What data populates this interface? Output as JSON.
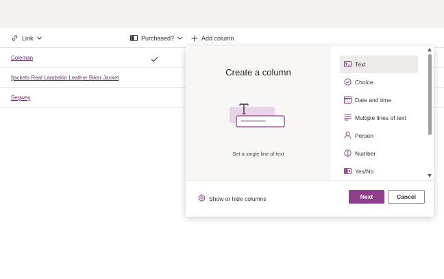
{
  "header": {
    "columns": [
      {
        "label": "Link",
        "icon": "link-icon"
      },
      {
        "label": "Purchased?",
        "icon": "yes-no-icon"
      },
      {
        "label": "Add column",
        "icon": "plus-icon"
      }
    ]
  },
  "rows": [
    {
      "link": "Coleman",
      "purchased": true
    },
    {
      "link": "fjackets Real Lambskin Leather Biker Jacket",
      "purchased": false
    },
    {
      "link": "Segway",
      "purchased": false
    }
  ],
  "panel": {
    "title": "Create a column",
    "description": "Set a single line of text",
    "types": [
      {
        "label": "Text",
        "icon": "text-icon",
        "selected": true
      },
      {
        "label": "Choice",
        "icon": "choice-icon",
        "selected": false
      },
      {
        "label": "Date and time",
        "icon": "calendar-icon",
        "selected": false
      },
      {
        "label": "Multiple lines of text",
        "icon": "multiline-icon",
        "selected": false
      },
      {
        "label": "Person",
        "icon": "person-icon",
        "selected": false
      },
      {
        "label": "Number",
        "icon": "number-icon",
        "selected": false
      },
      {
        "label": "Yes/No",
        "icon": "yes-no-icon",
        "selected": false
      }
    ],
    "show_hide_label": "Show or hide columns",
    "next_label": "Next",
    "cancel_label": "Cancel"
  },
  "colors": {
    "accent": "#8d3f8c",
    "link": "#6b2c6f",
    "icon_purple": "#8d3f8c",
    "selected_bg": "#edebe9"
  }
}
